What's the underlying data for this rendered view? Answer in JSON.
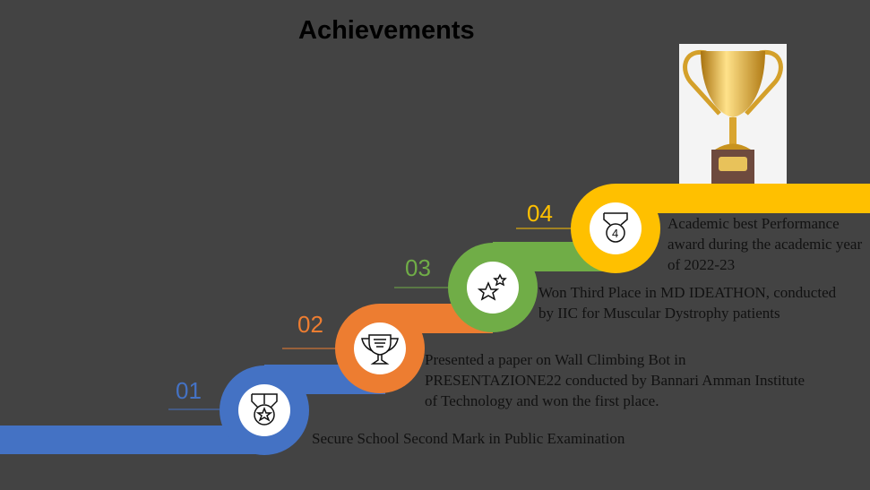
{
  "title": "Achievements",
  "colors": {
    "background": "#434343",
    "step1": "#4472c4",
    "step2": "#ed7d31",
    "step3": "#70ad47",
    "step4": "#ffc000"
  },
  "steps": [
    {
      "number": "01",
      "icon": "medal-star-icon",
      "text": "Secure School  Second  Mark in Public Examination"
    },
    {
      "number": "02",
      "icon": "trophy-cup-icon",
      "text": "Presented a paper on Wall Climbing Bot in PRESENTAZIONE22 conducted by Bannari Amman Institute of Technology and won the first place."
    },
    {
      "number": "03",
      "icon": "stars-icon",
      "text": "Won Third Place in MD IDEATHON, conducted by IIC for Muscular Dystrophy patients"
    },
    {
      "number": "04",
      "icon": "medal-number-icon",
      "icon_label": "4",
      "text": "Academic best Performance award during the academic year  of 2022-23"
    }
  ]
}
